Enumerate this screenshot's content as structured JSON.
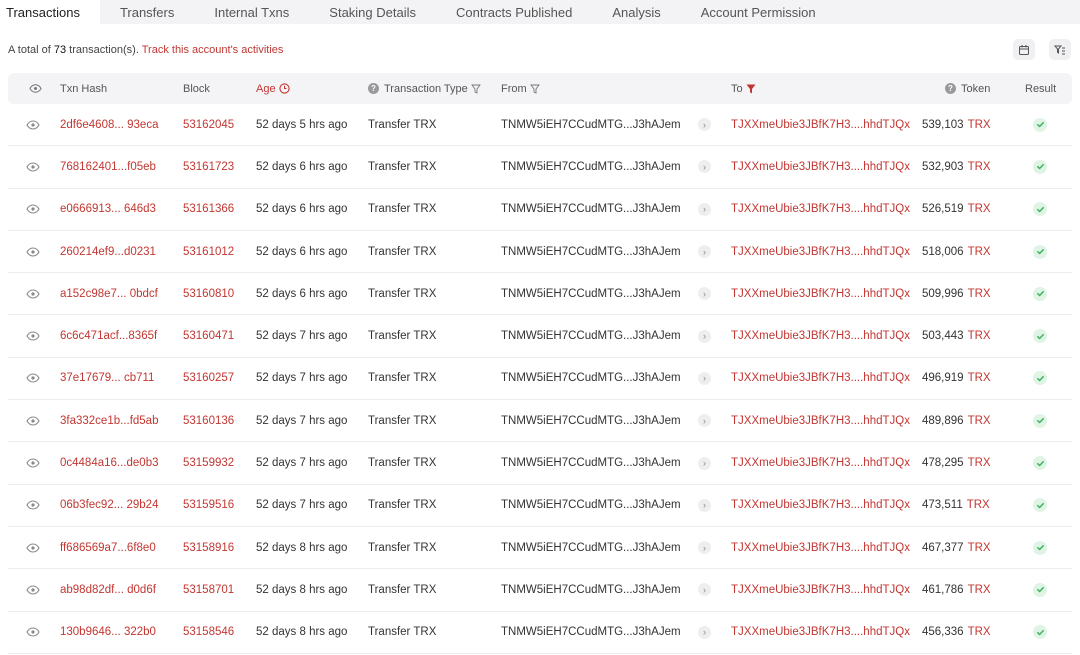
{
  "tabs": [
    {
      "label": "Transactions",
      "active": true
    },
    {
      "label": "Transfers"
    },
    {
      "label": "Internal Txns"
    },
    {
      "label": "Staking Details"
    },
    {
      "label": "Contracts Published"
    },
    {
      "label": "Analysis"
    },
    {
      "label": "Account Permission"
    }
  ],
  "summary": {
    "prefix": "A total of ",
    "count": "73",
    "suffix": " transaction(s). ",
    "link": "Track this account's activities"
  },
  "headers": {
    "hash": "Txn Hash",
    "block": "Block",
    "age": "Age",
    "type": "Transaction Type",
    "from": "From",
    "to": "To",
    "token": "Token",
    "result": "Result"
  },
  "colors": {
    "accent": "#c23631",
    "success": "#3bb35a",
    "header_bg": "#f4f4f7"
  },
  "rows": [
    {
      "hash": "2df6e4608... 93eca",
      "block": "53162045",
      "age": "52 days 5 hrs ago",
      "type": "Transfer TRX",
      "from": "TNMW5iEH7CCudMTG...J3hAJem",
      "to": "TJXXmeUbie3JBfK7H3....hhdTJQx",
      "amount": "539,103",
      "symbol": "TRX"
    },
    {
      "hash": "768162401...f05eb",
      "block": "53161723",
      "age": "52 days 6 hrs ago",
      "type": "Transfer TRX",
      "from": "TNMW5iEH7CCudMTG...J3hAJem",
      "to": "TJXXmeUbie3JBfK7H3....hhdTJQx",
      "amount": "532,903",
      "symbol": "TRX"
    },
    {
      "hash": "e0666913... 646d3",
      "block": "53161366",
      "age": "52 days 6 hrs ago",
      "type": "Transfer TRX",
      "from": "TNMW5iEH7CCudMTG...J3hAJem",
      "to": "TJXXmeUbie3JBfK7H3....hhdTJQx",
      "amount": "526,519",
      "symbol": "TRX"
    },
    {
      "hash": "260214ef9...d0231",
      "block": "53161012",
      "age": "52 days 6 hrs ago",
      "type": "Transfer TRX",
      "from": "TNMW5iEH7CCudMTG...J3hAJem",
      "to": "TJXXmeUbie3JBfK7H3....hhdTJQx",
      "amount": "518,006",
      "symbol": "TRX"
    },
    {
      "hash": "a152c98e7... 0bdcf",
      "block": "53160810",
      "age": "52 days 6 hrs ago",
      "type": "Transfer TRX",
      "from": "TNMW5iEH7CCudMTG...J3hAJem",
      "to": "TJXXmeUbie3JBfK7H3....hhdTJQx",
      "amount": "509,996",
      "symbol": "TRX"
    },
    {
      "hash": "6c6c471acf...8365f",
      "block": "53160471",
      "age": "52 days 7 hrs ago",
      "type": "Transfer TRX",
      "from": "TNMW5iEH7CCudMTG...J3hAJem",
      "to": "TJXXmeUbie3JBfK7H3....hhdTJQx",
      "amount": "503,443",
      "symbol": "TRX"
    },
    {
      "hash": "37e17679... cb711",
      "block": "53160257",
      "age": "52 days 7 hrs ago",
      "type": "Transfer TRX",
      "from": "TNMW5iEH7CCudMTG...J3hAJem",
      "to": "TJXXmeUbie3JBfK7H3....hhdTJQx",
      "amount": "496,919",
      "symbol": "TRX"
    },
    {
      "hash": "3fa332ce1b...fd5ab",
      "block": "53160136",
      "age": "52 days 7 hrs ago",
      "type": "Transfer TRX",
      "from": "TNMW5iEH7CCudMTG...J3hAJem",
      "to": "TJXXmeUbie3JBfK7H3....hhdTJQx",
      "amount": "489,896",
      "symbol": "TRX"
    },
    {
      "hash": "0c4484a16...de0b3",
      "block": "53159932",
      "age": "52 days 7 hrs ago",
      "type": "Transfer TRX",
      "from": "TNMW5iEH7CCudMTG...J3hAJem",
      "to": "TJXXmeUbie3JBfK7H3....hhdTJQx",
      "amount": "478,295",
      "symbol": "TRX"
    },
    {
      "hash": "06b3fec92... 29b24",
      "block": "53159516",
      "age": "52 days 7 hrs ago",
      "type": "Transfer TRX",
      "from": "TNMW5iEH7CCudMTG...J3hAJem",
      "to": "TJXXmeUbie3JBfK7H3....hhdTJQx",
      "amount": "473,511",
      "symbol": "TRX"
    },
    {
      "hash": "ff686569a7...6f8e0",
      "block": "53158916",
      "age": "52 days 8 hrs ago",
      "type": "Transfer TRX",
      "from": "TNMW5iEH7CCudMTG...J3hAJem",
      "to": "TJXXmeUbie3JBfK7H3....hhdTJQx",
      "amount": "467,377",
      "symbol": "TRX"
    },
    {
      "hash": "ab98d82df... d0d6f",
      "block": "53158701",
      "age": "52 days 8 hrs ago",
      "type": "Transfer TRX",
      "from": "TNMW5iEH7CCudMTG...J3hAJem",
      "to": "TJXXmeUbie3JBfK7H3....hhdTJQx",
      "amount": "461,786",
      "symbol": "TRX"
    },
    {
      "hash": "130b9646... 322b0",
      "block": "53158546",
      "age": "52 days 8 hrs ago",
      "type": "Transfer TRX",
      "from": "TNMW5iEH7CCudMTG...J3hAJem",
      "to": "TJXXmeUbie3JBfK7H3....hhdTJQx",
      "amount": "456,336",
      "symbol": "TRX"
    }
  ]
}
